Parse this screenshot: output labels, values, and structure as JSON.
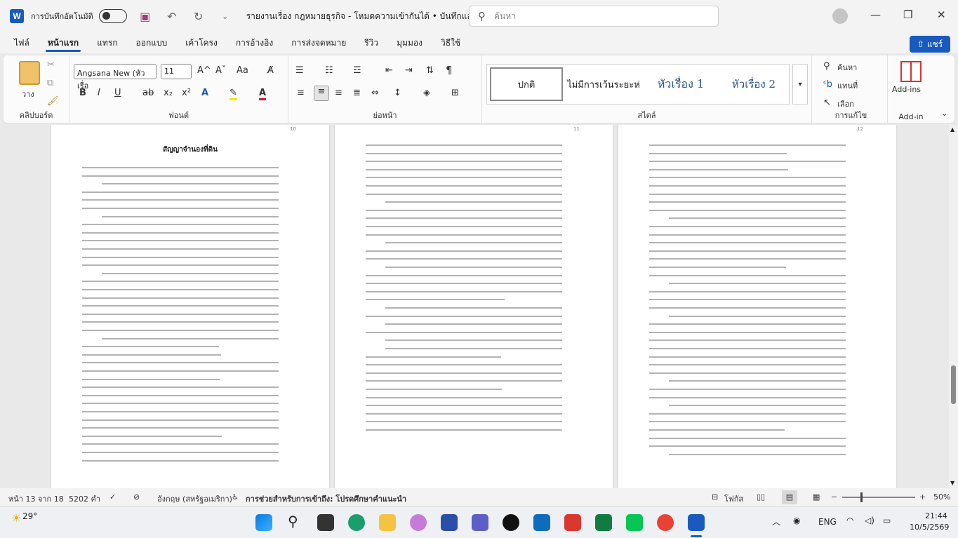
{
  "titlebar": {
    "app_icon": "W",
    "autosave_label": "การบันทึกอัตโนมัติ",
    "doc_title": "รายงานเรื่อง กฎหมายธุรกิจ  -  โหมดความเข้ากันได้  •  บันทึกแล้ว ∨",
    "search_placeholder": "ค้นหา",
    "save_icon": "save-icon",
    "undo_icon": "undo-icon",
    "redo_icon": "redo-icon"
  },
  "menu": {
    "tabs": [
      "ไฟล์",
      "หน้าแรก",
      "แทรก",
      "ออกแบบ",
      "เค้าโครง",
      "การอ้างอิง",
      "การส่งจดหมาย",
      "รีวิว",
      "มุมมอง",
      "วิธีใช้"
    ],
    "share": "แชร์"
  },
  "ribbon": {
    "clipboard": {
      "paste": "วาง",
      "label": "คลิปบอร์ด"
    },
    "font": {
      "family": "Angsana New (หัวเรื่อ",
      "size": "11",
      "label": "ฟอนต์",
      "grow": "A^",
      "shrink": "Aˇ",
      "case": "Aa",
      "bold": "B",
      "italic": "I",
      "underline": "U",
      "strike": "ab",
      "sub": "x₂",
      "sup": "x²"
    },
    "paragraph": {
      "label": "ย่อหน้า",
      "pilcrow": "¶"
    },
    "styles": {
      "items": [
        "ปกติ",
        "ไม่มีการเว้นระยะห่",
        "หัวเรื่อง 1",
        "หัวเรื่อง 2"
      ],
      "label": "สไตล์"
    },
    "editing": {
      "find": "ค้นหา",
      "replace": "แทนที่",
      "select": "เลือก",
      "label": "การแก้ไข"
    },
    "addin": {
      "button": "Add-ins",
      "label": "Add-in"
    }
  },
  "document": {
    "page_numbers": [
      "10",
      "11",
      "12"
    ],
    "page1_title": "สัญญาจำนองที่ดิน"
  },
  "status": {
    "page": "หน้า 13 จาก 18",
    "words": "5202 คำ",
    "language": "อังกฤษ (สหรัฐอเมริกา)",
    "accessibility": "การช่วยสำหรับการเข้าถึง: โปรดศึกษาคำแนะนำ",
    "focus": "โฟกัส",
    "zoom": "50%"
  },
  "taskbar": {
    "weather": "29°",
    "lang": "ENG",
    "time": "21:44",
    "date": "10/5/2569"
  },
  "colors": {
    "accent": "#185abd",
    "save": "#a03c79"
  }
}
